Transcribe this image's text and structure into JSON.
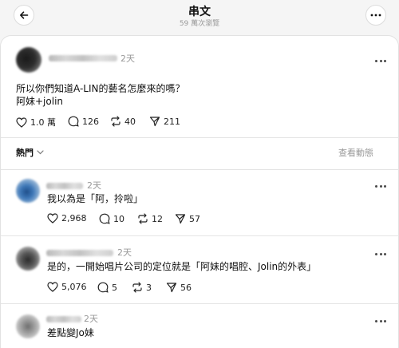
{
  "header": {
    "title": "串文",
    "views": "59 萬次瀏覽"
  },
  "post": {
    "time": "2天",
    "line1": "所以你們知道A-LIN的藝名怎麼來的嗎？",
    "line2": "阿妹+jolin",
    "likes": "1.0 萬",
    "comments": "126",
    "reposts": "40",
    "shares": "211"
  },
  "sort": {
    "label": "熱門",
    "activity": "查看動態"
  },
  "replies": [
    {
      "time": "2天",
      "text": "我以為是「阿，拎啦」",
      "likes": "2,968",
      "comments": "10",
      "reposts": "12",
      "shares": "57"
    },
    {
      "time": "2天",
      "text": "是的，一開始唱片公司的定位就是「阿妹的唱腔、Jolin的外表」",
      "likes": "5,076",
      "comments": "5",
      "reposts": "3",
      "shares": "56"
    },
    {
      "time": "2天",
      "text": "差點變Jo妹"
    }
  ],
  "icons": {
    "back": "arrow-left-icon",
    "more": "more-horizontal-icon",
    "like": "heart-icon",
    "comment": "comment-icon",
    "repost": "repost-icon",
    "share": "send-icon",
    "dropdown": "chevron-down-icon"
  },
  "colors": {
    "background": "#f5f5f5",
    "card": "#ffffff",
    "text": "#101010",
    "muted": "#999999",
    "divider": "#e4e4e4"
  }
}
